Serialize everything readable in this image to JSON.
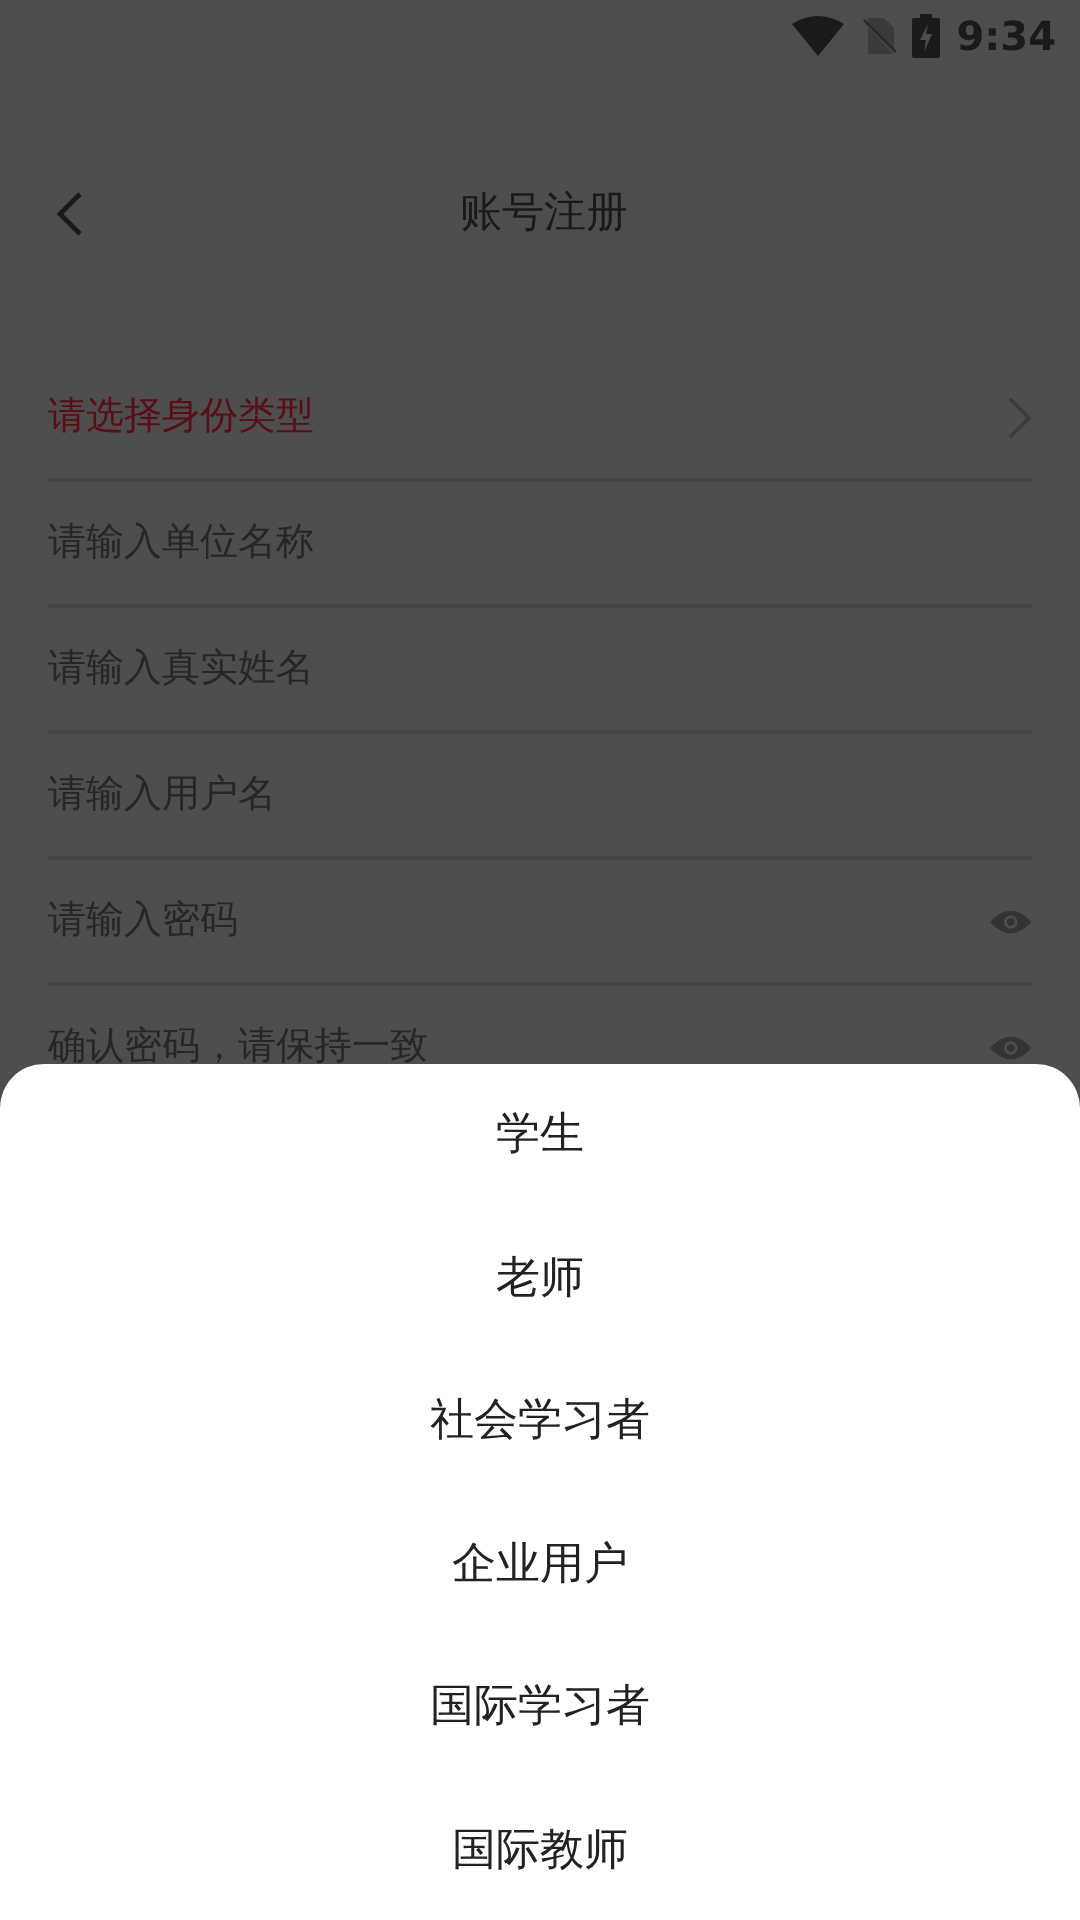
{
  "status_bar": {
    "time": "9:34"
  },
  "header": {
    "title": "账号注册"
  },
  "form_fields": [
    {
      "kind": "select",
      "placeholder": "请选择身份类型"
    },
    {
      "kind": "text",
      "placeholder": "请输入单位名称"
    },
    {
      "kind": "text",
      "placeholder": "请输入真实姓名"
    },
    {
      "kind": "text",
      "placeholder": "请输入用户名"
    },
    {
      "kind": "password",
      "placeholder": "请输入密码"
    },
    {
      "kind": "password",
      "placeholder": "确认密码，请保持一致"
    }
  ],
  "bottom_sheet": {
    "options": [
      {
        "label": "学生"
      },
      {
        "label": "老师"
      },
      {
        "label": "社会学习者"
      },
      {
        "label": "企业用户"
      },
      {
        "label": "国际学习者"
      },
      {
        "label": "国际教师"
      }
    ]
  }
}
